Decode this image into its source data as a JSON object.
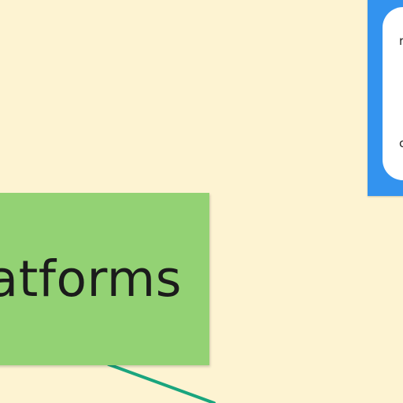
{
  "canvas": {
    "background": "#fdf3d2"
  },
  "green_card": {
    "label": "atforms",
    "color": "#93d274"
  },
  "blue_card": {
    "color": "#3393ef",
    "inner_color": "#ffffff",
    "lines": [
      "r",
      "c"
    ]
  },
  "connector": {
    "color": "#1aa57e"
  }
}
